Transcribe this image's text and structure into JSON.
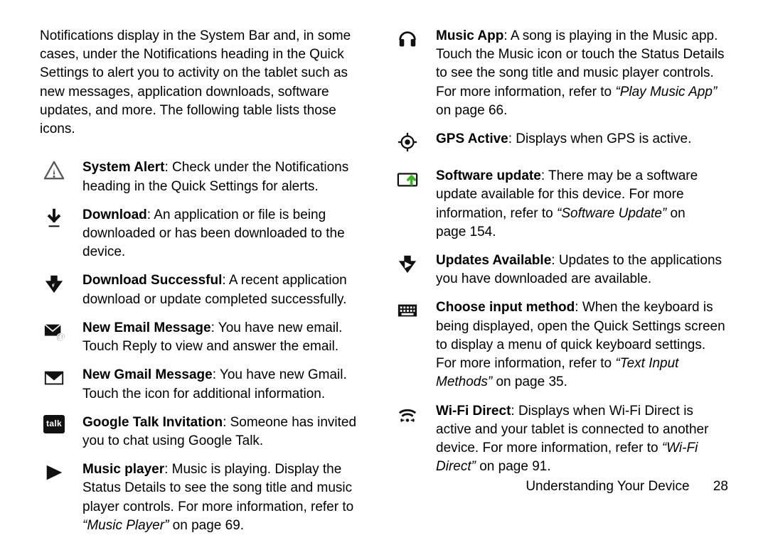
{
  "intro": "Notifications display in the System Bar and, in some cases, under the Notifications heading in the Quick Settings to alert you to activity on the tablet such as new messages, application downloads, software updates, and more. The following table lists those icons.",
  "left": [
    {
      "title": "System Alert",
      "body": ": Check under the Notifications heading in the Quick Settings for alerts."
    },
    {
      "title": "Download",
      "body": ": An application or file is being downloaded or has been downloaded to the device."
    },
    {
      "title": "Download Successful",
      "body": ": A recent application download or update completed successfully."
    },
    {
      "title": "New Email Message",
      "body": ": You have new email. Touch Reply to view and answer the email."
    },
    {
      "title": "New Gmail Message",
      "body": ": You have new Gmail. Touch the icon for additional information."
    },
    {
      "title": "Google Talk Invitation",
      "body": ": Someone has invited you to chat using Google Talk."
    },
    {
      "title": "Music player",
      "body": ": Music is playing. Display the Status Details to see the song title and music player controls. For more information, refer to ",
      "ref": "“Music Player”",
      "tail": " on page 69."
    }
  ],
  "right": [
    {
      "title": "Music App",
      "body": ": A song is playing in the Music app. Touch the Music icon or touch the Status Details to see the song title and music player controls. For more information, refer to ",
      "ref": "“Play Music App”",
      "tail": " on page 66."
    },
    {
      "title": "GPS Active",
      "body": ": Displays when GPS is active."
    },
    {
      "title": "Software update",
      "body": ": There may be a software update available for this device. For more information, refer to ",
      "ref": "“Software Update”",
      "tail": " on page 154."
    },
    {
      "title": "Updates Available",
      "body": ": Updates to the applications you have downloaded are available."
    },
    {
      "title": "Choose input method",
      "body": ": When the keyboard is being displayed, open the Quick Settings screen to display a menu of quick keyboard settings. For more information, refer to ",
      "ref": "“Text Input Methods”",
      "tail": " on page 35."
    },
    {
      "title": "Wi-Fi Direct",
      "body": ": Displays when Wi-Fi Direct is active and your tablet is connected to another device. For more information, refer to ",
      "ref": "“Wi-Fi Direct”",
      "tail": " on page 91."
    }
  ],
  "footer": {
    "section": "Understanding Your Device",
    "page": "28"
  },
  "talk_label": "talk"
}
